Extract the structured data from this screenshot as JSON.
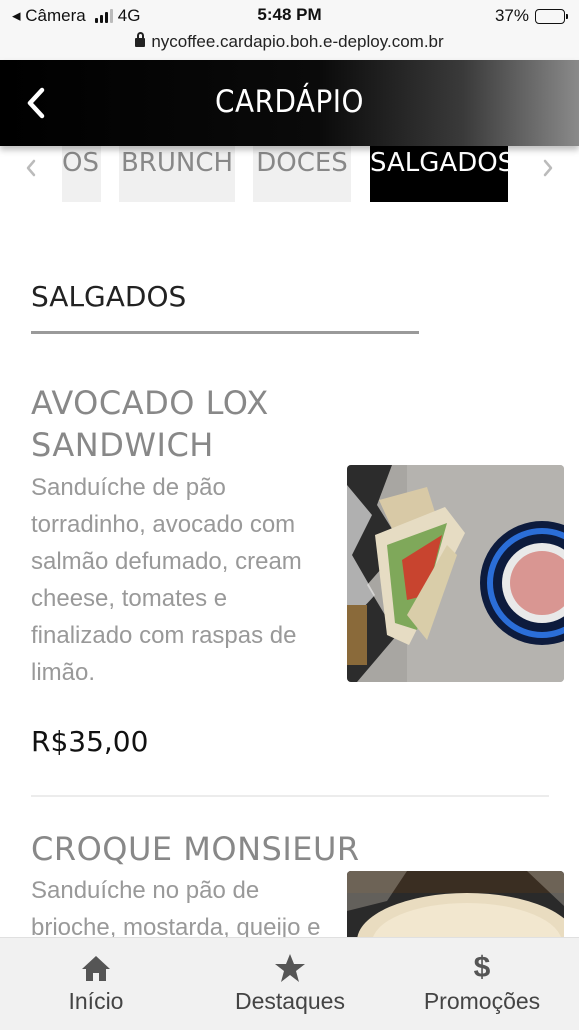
{
  "status_bar": {
    "carrier": "◂ Câmera",
    "network": "4G",
    "time": "5:48 PM",
    "battery_percent": "37%",
    "battery_level": 0.37
  },
  "browser": {
    "url": "nycoffee.cardapio.boh.e-deploy.com.br"
  },
  "header": {
    "title": "CARDÁPIO"
  },
  "tabs": {
    "items": [
      {
        "label": "OS",
        "active": false
      },
      {
        "label": "BRUNCH",
        "active": false
      },
      {
        "label": "DOCES",
        "active": false
      },
      {
        "label": "SALGADOS",
        "active": true
      }
    ]
  },
  "section": {
    "title": "SALGADOS"
  },
  "items": [
    {
      "name_line1": "AVOCADO LOX",
      "name_line2": "SANDWICH",
      "description": "Sanduíche de pão torradinho, avocado com salmão defumado, cream cheese, tomates e finalizado com raspas de limão.",
      "price": "R$35,00"
    },
    {
      "name_line1": "CROQUE MONSIEUR",
      "description": "Sanduíche no pão de brioche, mostarda, queijo e"
    }
  ],
  "bottom_nav": {
    "items": [
      {
        "label": "Início",
        "icon": "home-icon"
      },
      {
        "label": "Destaques",
        "icon": "star-icon"
      },
      {
        "label": "Promoções",
        "icon": "dollar-icon",
        "glyph": "$"
      }
    ]
  },
  "colors": {
    "header_bg": "#000000",
    "active_tab": "#000000",
    "inactive_tab": "#f0f0f0"
  }
}
